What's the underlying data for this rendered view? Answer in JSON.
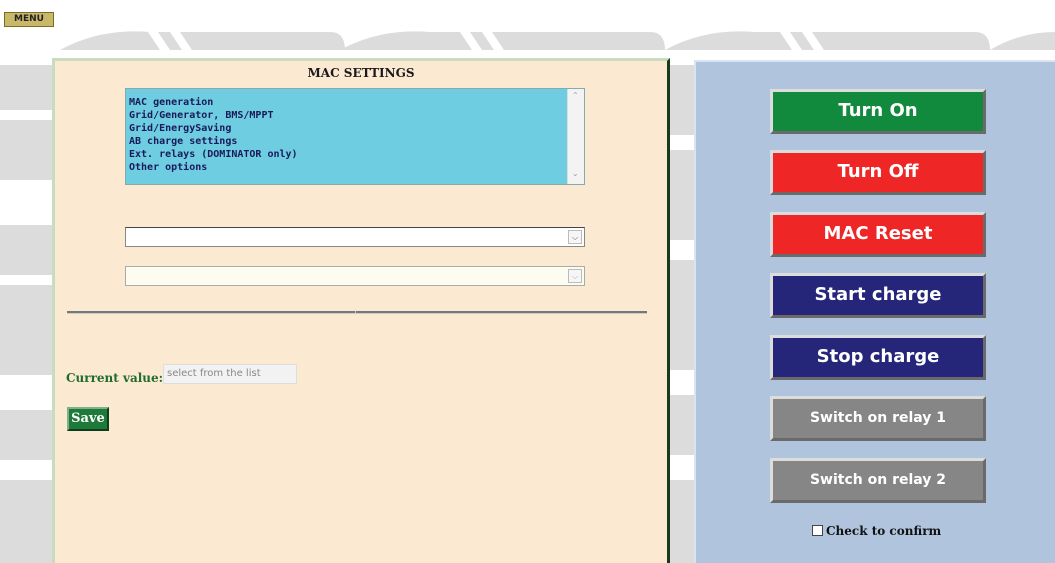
{
  "menu": {
    "label": "MENU"
  },
  "left_panel": {
    "title": "MAC SETTINGS",
    "settings_list": [
      "MAC generation",
      "Grid/Generator, BMS/MPPT",
      "Grid/EnergySaving",
      "AB charge settings",
      "Ext. relays (DOMINATOR only)",
      "Other options"
    ],
    "select_1": {
      "value": ""
    },
    "select_2": {
      "value": ""
    },
    "current_value": {
      "label": "Current value:",
      "placeholder": "select from the list"
    },
    "save_label": "Save"
  },
  "right_panel": {
    "buttons": [
      {
        "label": "Turn On",
        "color": "#128a3e"
      },
      {
        "label": "Turn Off",
        "color": "#ef2626"
      },
      {
        "label": "MAC Reset",
        "color": "#ef2626"
      },
      {
        "label": "Start charge",
        "color": "#25267a"
      },
      {
        "label": "Stop charge",
        "color": "#25267a"
      },
      {
        "label": "Switch on relay 1",
        "color": "#868686"
      },
      {
        "label": "Switch on relay 2",
        "color": "#868686"
      }
    ],
    "confirm_label": "Check to confirm"
  }
}
